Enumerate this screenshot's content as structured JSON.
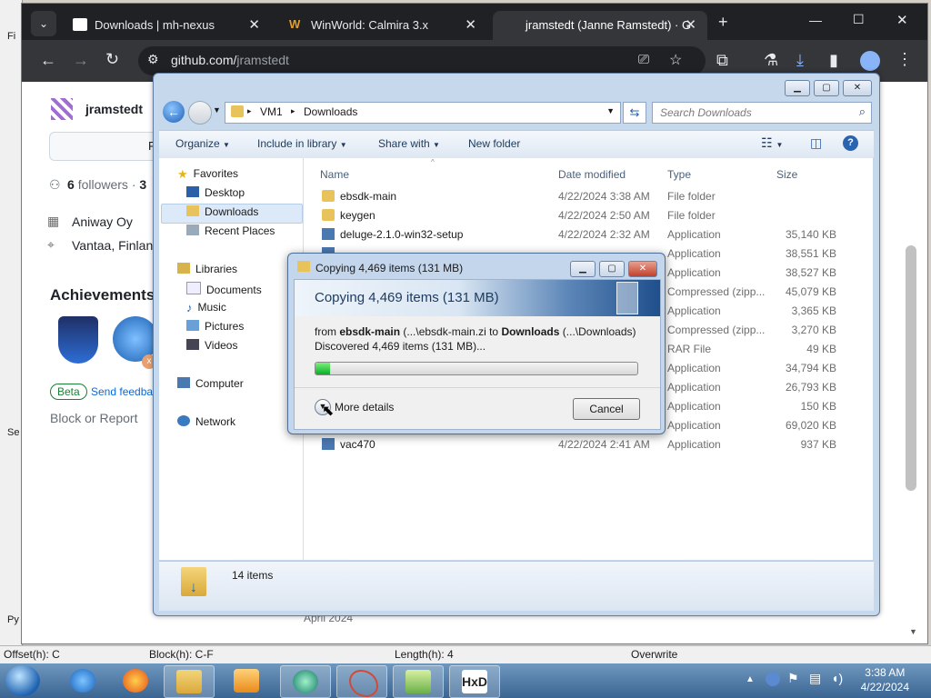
{
  "hex_editor": {
    "status": {
      "offset": "Offset(h): C",
      "block": "Block(h): C-F",
      "length": "Length(h): 4",
      "mode": "Overwrite"
    },
    "left_fragments": [
      "Fi",
      "Se",
      "Py"
    ]
  },
  "browser": {
    "tabs": [
      {
        "title": "Downloads | mh-nexus",
        "active": false
      },
      {
        "title": "WinWorld: Calmira 3.x",
        "active": false
      },
      {
        "title": "jramstedt (Janne Ramstedt) · G",
        "active": true
      }
    ],
    "new_tab_glyph": "+",
    "url_host": "github.com/",
    "url_path": "jramstedt",
    "window_controls": {
      "minimize": "—",
      "maximize": "☐",
      "close": "✕"
    }
  },
  "github_profile": {
    "username": "jramstedt",
    "follow_fragment": "F",
    "followers_count": "6",
    "followers_label": "followers",
    "separator": "·",
    "following_count": "3",
    "company": "Aniway Oy",
    "location": "Vantaa, Finland",
    "achievements_heading": "Achievements",
    "achievement_badge_count": "x",
    "beta_label": "Beta",
    "feedback_link": "Send feedback",
    "block_report": "Block or Report",
    "contrib_month": "April 2024"
  },
  "explorer": {
    "breadcrumb": [
      "VM1",
      "Downloads"
    ],
    "search_placeholder": "Search Downloads",
    "commands": {
      "organize": "Organize",
      "include_in_library": "Include in library",
      "share_with": "Share with",
      "new_folder": "New folder"
    },
    "nav": {
      "favorites": "Favorites",
      "desktop": "Desktop",
      "downloads": "Downloads",
      "recent_places": "Recent Places",
      "libraries": "Libraries",
      "documents": "Documents",
      "music": "Music",
      "pictures": "Pictures",
      "videos": "Videos",
      "computer": "Computer",
      "network": "Network"
    },
    "columns": {
      "name": "Name",
      "date": "Date modified",
      "type": "Type",
      "size": "Size"
    },
    "files": [
      {
        "name": "ebsdk-main",
        "date": "4/22/2024 3:38 AM",
        "type": "File folder",
        "size": ""
      },
      {
        "name": "keygen",
        "date": "4/22/2024 2:50 AM",
        "type": "File folder",
        "size": ""
      },
      {
        "name": "deluge-2.1.0-win32-setup",
        "date": "4/22/2024 2:32 AM",
        "type": "Application",
        "size": "35,140 KB"
      },
      {
        "name": "",
        "date": "",
        "type": "Application",
        "size": "38,551 KB"
      },
      {
        "name": "",
        "date": "",
        "type": "Application",
        "size": "38,527 KB"
      },
      {
        "name": "",
        "date": "",
        "type": "Compressed (zipp...",
        "size": "45,079 KB"
      },
      {
        "name": "",
        "date": "",
        "type": "Application",
        "size": "3,365 KB"
      },
      {
        "name": "",
        "date": "",
        "type": "Compressed (zipp...",
        "size": "3,270 KB"
      },
      {
        "name": "",
        "date": "",
        "type": "RAR File",
        "size": "49 KB"
      },
      {
        "name": "",
        "date": "",
        "type": "Application",
        "size": "34,794 KB"
      },
      {
        "name": "",
        "date": "",
        "type": "Application",
        "size": "26,793 KB"
      },
      {
        "name": "",
        "date": "",
        "type": "Application",
        "size": "150 KB"
      },
      {
        "name": "",
        "date": "",
        "type": "Application",
        "size": "69,020 KB"
      },
      {
        "name": "vac470",
        "date": "4/22/2024 2:41 AM",
        "type": "Application",
        "size": "937 KB"
      }
    ],
    "item_count": "14 items"
  },
  "copy_dialog": {
    "title": "Copying 4,469 items (131 MB)",
    "heading": "Copying 4,469 items (131 MB)",
    "from_label": "from",
    "source": "ebsdk-main",
    "source_path": "(...\\ebsdk-main.zi",
    "to_label": "to",
    "dest": "Downloads",
    "dest_path": "(...\\Downloads)",
    "discovered": "Discovered 4,469 items (131 MB)...",
    "progress_fraction": 0.045,
    "more_details": "More details",
    "cancel": "Cancel"
  },
  "taskbar": {
    "time": "3:38 AM",
    "date": "4/22/2024",
    "apps": [
      "start",
      "internet-explorer",
      "firefox",
      "explorer",
      "media-player",
      "app-circle",
      "app-ribbon",
      "notepad-plus",
      "hxd"
    ]
  },
  "colors": {
    "chrome_dark": "#202124",
    "progress_green": "#06b025",
    "accent_blue": "#0969da"
  }
}
